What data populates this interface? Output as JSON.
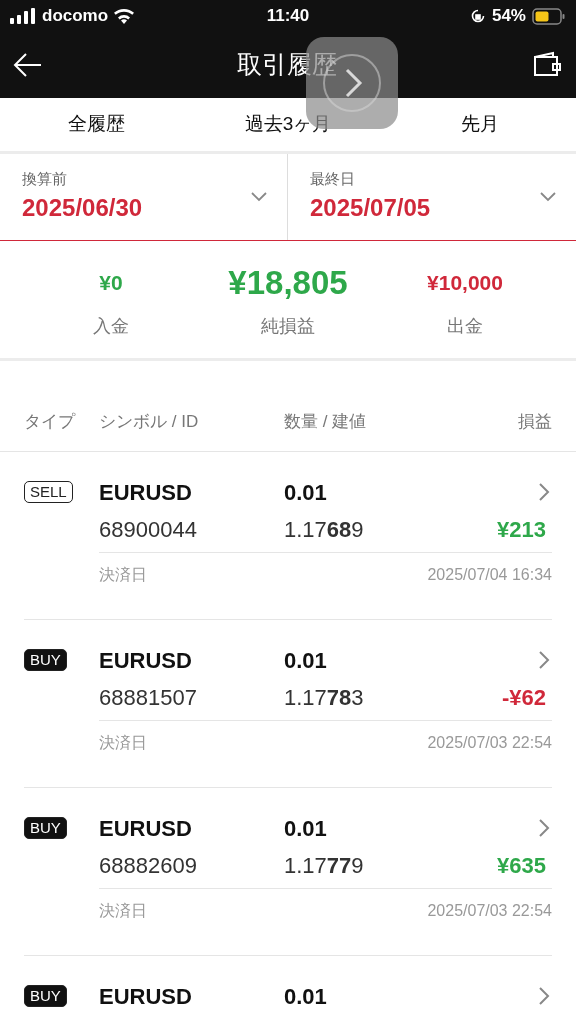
{
  "status_bar": {
    "carrier": "docomo",
    "time": "11:40",
    "battery": "54%"
  },
  "header": {
    "title": "取引履歴"
  },
  "tabs": [
    {
      "label": "全履歴"
    },
    {
      "label": "過去3ヶ月"
    },
    {
      "label": "先月"
    }
  ],
  "date_range": [
    {
      "label": "換算前",
      "value": "2025/06/30"
    },
    {
      "label": "最終日",
      "value": "2025/07/05"
    }
  ],
  "summary": [
    {
      "value": "¥0",
      "label": "入金",
      "color": "#2ea84a",
      "kind": "side"
    },
    {
      "value": "¥18,805",
      "label": "純損益",
      "color": "#2ea84a",
      "kind": "main"
    },
    {
      "value": "¥10,000",
      "label": "出金",
      "color": "#d0283a",
      "kind": "side"
    }
  ],
  "columns": [
    "タイプ",
    "シンボル / ID",
    "数量 / 建値",
    "損益"
  ],
  "trades": [
    {
      "type": "SELL",
      "symbol": "EURUSD",
      "volume": "0.01",
      "id": "68900044",
      "price": "1.17**68**9",
      "profit": "¥213",
      "color": "#2ea84a",
      "date_label": "決済日",
      "date": "2025/07/04 16:34"
    },
    {
      "type": "BUY",
      "symbol": "EURUSD",
      "volume": "0.01",
      "id": "68881507",
      "price": "1.17**78**3",
      "profit": "-¥62",
      "color": "#d0283a",
      "date_label": "決済日",
      "date": "2025/07/03 22:54"
    },
    {
      "type": "BUY",
      "symbol": "EURUSD",
      "volume": "0.01",
      "id": "68882609",
      "price": "1.17**77**9",
      "profit": "¥635",
      "color": "#2ea84a",
      "date_label": "決済日",
      "date": "2025/07/03 22:54"
    },
    {
      "type": "BUY",
      "symbol": "EURUSD",
      "volume": "0.01"
    }
  ]
}
